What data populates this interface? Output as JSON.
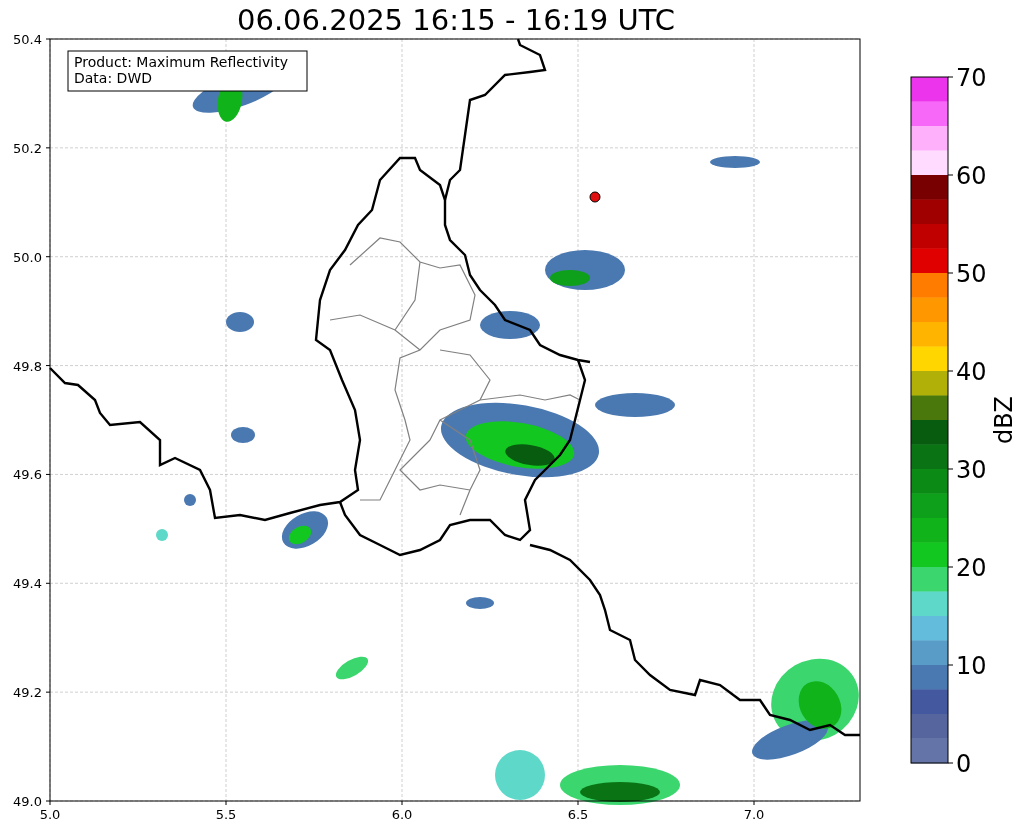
{
  "title": "06.06.2025 16:15 - 16:19 UTC",
  "info_box": [
    "Product: Maximum Reflectivity",
    "Data: DWD"
  ],
  "map": {
    "xticks": [
      "5.0",
      "5.5",
      "6.0",
      "6.5",
      "7.0"
    ],
    "yticks": [
      "50.4",
      "50.2",
      "50.0",
      "49.8",
      "49.6",
      "49.4",
      "49.2",
      "49.0"
    ]
  },
  "colorbar": {
    "label": "dBZ",
    "ticks": [
      "70",
      "60",
      "50",
      "40",
      "30",
      "20",
      "10",
      "0"
    ],
    "segments": [
      {
        "color": "#ec34ec"
      },
      {
        "color": "#f868f8"
      },
      {
        "color": "#ffb0fa"
      },
      {
        "color": "#ffdcff"
      },
      {
        "color": "#780000"
      },
      {
        "color": "#a00000"
      },
      {
        "color": "#c00000"
      },
      {
        "color": "#e00000"
      },
      {
        "color": "#ff7c00"
      },
      {
        "color": "#ff9800"
      },
      {
        "color": "#ffb400"
      },
      {
        "color": "#ffd600"
      },
      {
        "color": "#b0b008"
      },
      {
        "color": "#4a780c"
      },
      {
        "color": "#085c10"
      },
      {
        "color": "#0a7414"
      },
      {
        "color": "#0c8a16"
      },
      {
        "color": "#0ea01a"
      },
      {
        "color": "#10b41a"
      },
      {
        "color": "#12c820"
      },
      {
        "color": "#3cd66e"
      },
      {
        "color": "#5ed8c8"
      },
      {
        "color": "#64bcdc"
      },
      {
        "color": "#5a9cc8"
      },
      {
        "color": "#4a78b0"
      },
      {
        "color": "#4458a0"
      },
      {
        "color": "#56659e"
      },
      {
        "color": "#6474a8"
      }
    ]
  }
}
